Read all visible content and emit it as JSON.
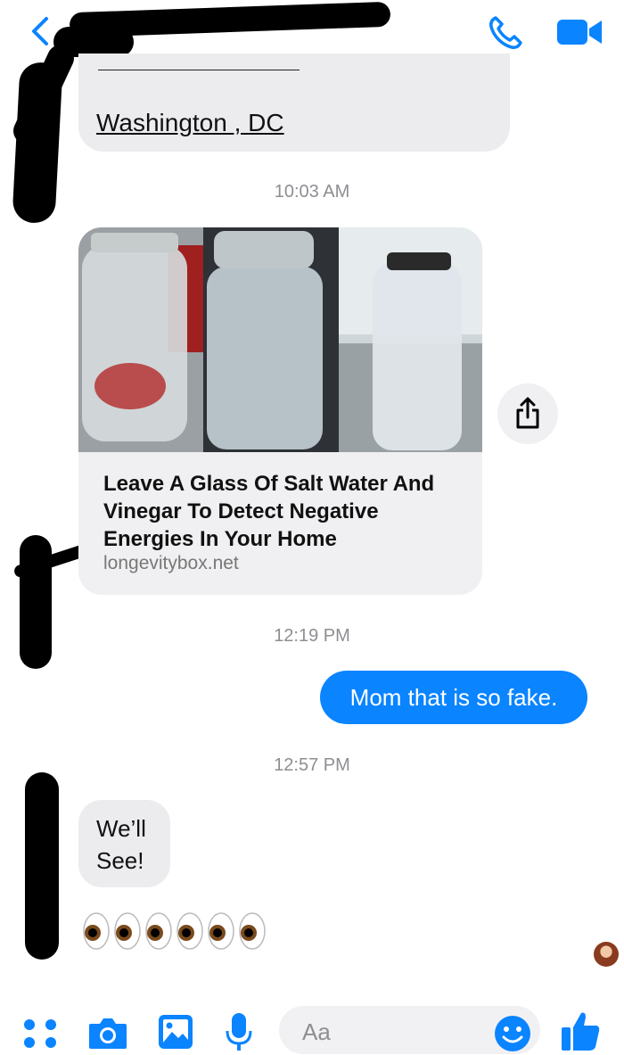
{
  "header": {
    "back_icon": "chevron-left-icon",
    "call_icon": "phone-icon",
    "video_icon": "video-camera-icon",
    "accent": "#0a84ff"
  },
  "messages": {
    "location_link": "Washington , DC",
    "time1": "10:03 AM",
    "card": {
      "title": "Leave A Glass Of Salt Water And Vinegar To Detect Negative Energies In Your Home",
      "domain": "longevitybox.net"
    },
    "time2": "12:19 PM",
    "outgoing": "Mom that is so fake.",
    "time3": "12:57 PM",
    "incoming_line1": "We’ll",
    "incoming_line2": "See!",
    "emoji_count": 6
  },
  "composer": {
    "placeholder": "Aa",
    "icons": [
      "apps-icon",
      "camera-icon",
      "photo-icon",
      "microphone-icon",
      "smile-icon",
      "thumbs-up-icon"
    ]
  }
}
